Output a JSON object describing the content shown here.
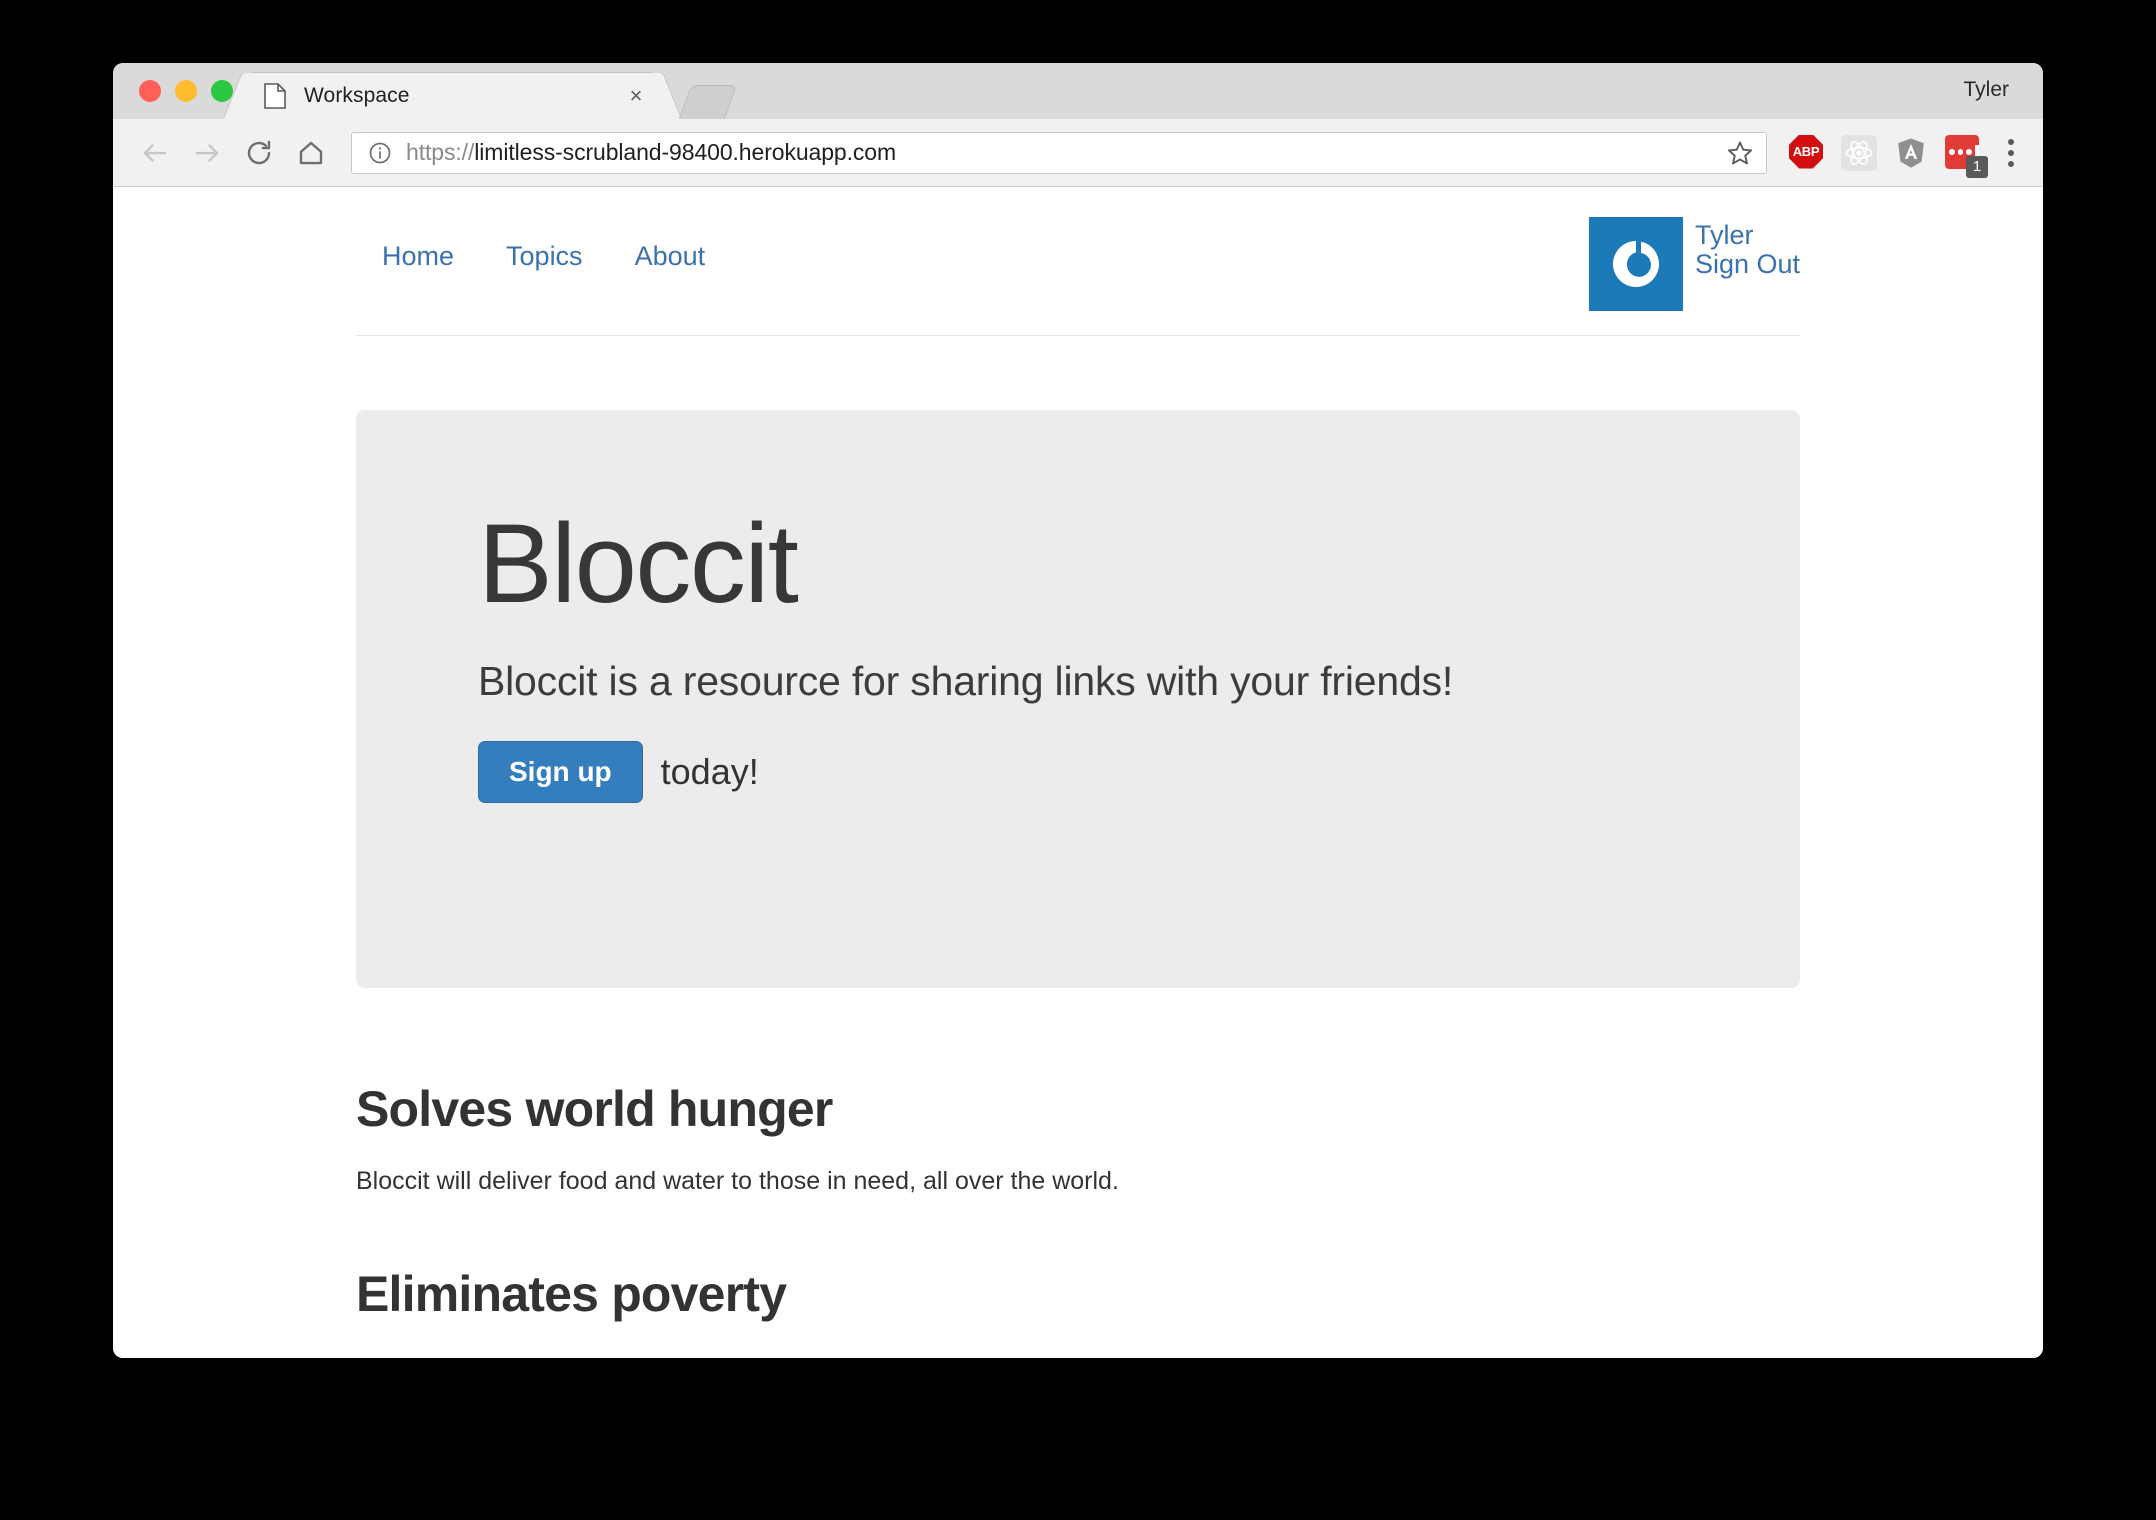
{
  "browser": {
    "profile_name": "Tyler",
    "tab": {
      "title": "Workspace",
      "favicon": "page-icon",
      "close_label": "×"
    },
    "new_tab_label": "",
    "toolbar": {
      "back": "back-arrow-icon",
      "forward": "forward-arrow-icon",
      "reload": "reload-icon",
      "home": "home-icon",
      "info": "info-circle-icon",
      "star": "bookmark-star-icon",
      "url_scheme": "https://",
      "url_rest": "limitless-scrubland-98400.herokuapp.com",
      "url_full": "https://limitless-scrubland-98400.herokuapp.com"
    },
    "extensions": [
      {
        "name": "adblock-plus-icon",
        "label": "ABP",
        "badge": ""
      },
      {
        "name": "react-devtools-icon",
        "label": "",
        "badge": ""
      },
      {
        "name": "angular-devtools-icon",
        "label": "A",
        "badge": ""
      },
      {
        "name": "red-extension-icon",
        "label": "",
        "badge": "1"
      }
    ],
    "menu": "chrome-menu-icon"
  },
  "site": {
    "nav": [
      {
        "label": "Home"
      },
      {
        "label": "Topics"
      },
      {
        "label": "About"
      }
    ],
    "user": {
      "avatar": "gravatar-power-icon",
      "name": "Tyler",
      "sign_out": "Sign Out"
    },
    "jumbotron": {
      "title": "Bloccit",
      "subtitle": "Bloccit is a resource for sharing links with your friends!",
      "cta_button": "Sign up",
      "cta_suffix": "today!"
    },
    "features": [
      {
        "title": "Solves world hunger",
        "body": "Bloccit will deliver food and water to those in need, all over the world."
      },
      {
        "title": "Eliminates poverty",
        "body": ""
      }
    ]
  },
  "colors": {
    "link_blue": "#3a72ad",
    "button_blue": "#357ebd",
    "avatar_blue": "#1c7ab8",
    "jumbotron_bg": "#ececec",
    "heading_gray": "#373737"
  }
}
